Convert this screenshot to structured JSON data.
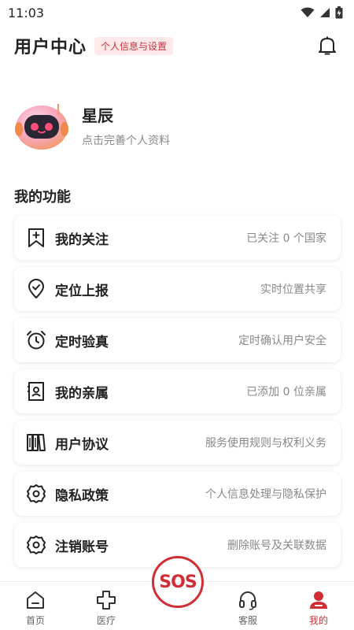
{
  "status_bar": {
    "time": "11:03",
    "icons": [
      "wifi-icon",
      "signal-icon",
      "battery-icon"
    ]
  },
  "header": {
    "title": "用户中心",
    "tag": "个人信息与设置",
    "bell_icon": "bell-icon"
  },
  "profile": {
    "name": "星辰",
    "subtitle": "点击完善个人资料",
    "avatar_icon": "robot-avatar"
  },
  "section": {
    "title": "我的功能"
  },
  "menu": [
    {
      "label": "我的关注",
      "desc": "已关注 0 个国家",
      "icon": "bookmark-icon"
    },
    {
      "label": "定位上报",
      "desc": "实时位置共享",
      "icon": "location-icon"
    },
    {
      "label": "定时验真",
      "desc": "定时确认用户安全",
      "icon": "alarm-icon"
    },
    {
      "label": "我的亲属",
      "desc": "已添加 0 位亲属",
      "icon": "contact-icon"
    },
    {
      "label": "用户协议",
      "desc": "服务使用规则与权利义务",
      "icon": "book-icon"
    },
    {
      "label": "隐私政策",
      "desc": "个人信息处理与隐私保护",
      "icon": "gear-icon"
    },
    {
      "label": "注销账号",
      "desc": "删除账号及关联数据",
      "icon": "gear-icon"
    }
  ],
  "nav": {
    "items": [
      {
        "label": "首页",
        "icon": "home-icon"
      },
      {
        "label": "医疗",
        "icon": "medical-cross-icon"
      },
      {
        "label": "客服",
        "icon": "headset-icon"
      },
      {
        "label": "我的",
        "icon": "user-icon"
      }
    ],
    "active": "我的",
    "sos_label": "SOS"
  },
  "colors": {
    "accent": "#d02d34",
    "tag_bg": "#fde8ea",
    "muted": "#888888"
  }
}
